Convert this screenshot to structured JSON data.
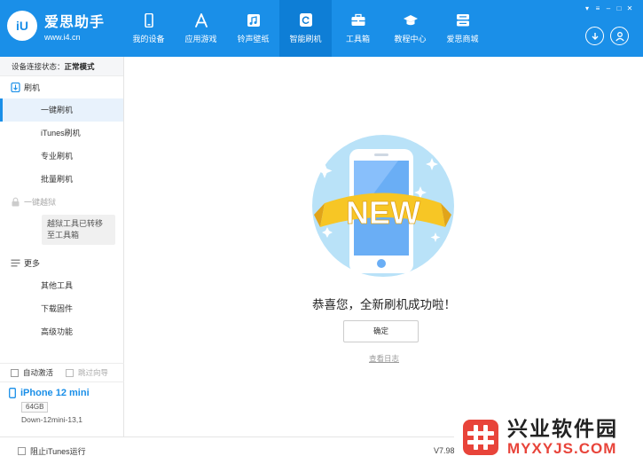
{
  "app": {
    "logo_badge": "iU",
    "name": "爱思助手",
    "url": "www.i4.cn"
  },
  "nav": {
    "items": [
      {
        "label": "我的设备",
        "icon": "phone-icon"
      },
      {
        "label": "应用游戏",
        "icon": "app-store-icon"
      },
      {
        "label": "铃声壁纸",
        "icon": "music-wallpaper-icon"
      },
      {
        "label": "智能刷机",
        "icon": "flash-refresh-icon",
        "active": true
      },
      {
        "label": "工具箱",
        "icon": "toolbox-icon"
      },
      {
        "label": "教程中心",
        "icon": "graduation-cap-icon"
      },
      {
        "label": "爱思商城",
        "icon": "store-icon"
      }
    ]
  },
  "window_controls": [
    "▾",
    "≡",
    "–",
    "□",
    "✕"
  ],
  "sidebar": {
    "status_label": "设备连接状态：",
    "status_value": "正常模式",
    "flash_section": "刷机",
    "flash_items": [
      "一键刷机",
      "iTunes刷机",
      "专业刷机",
      "批量刷机"
    ],
    "jailbreak_section": "一键越狱",
    "jailbreak_note": "越狱工具已转移至工具箱",
    "more_section": "更多",
    "more_items": [
      "其他工具",
      "下载固件",
      "高级功能"
    ],
    "auto_activate": "自动激活",
    "skip_guide": "跳过向导",
    "device_name": "iPhone 12 mini",
    "device_capacity": "64GB",
    "device_model": "Down-12mini-13,1"
  },
  "main": {
    "badge_text": "NEW",
    "success_message": "恭喜您，全新刷机成功啦！",
    "ok_button": "确定",
    "view_log": "查看日志"
  },
  "footer": {
    "block_itunes": "阻止iTunes运行",
    "version": "V7.98"
  },
  "watermark": {
    "cn": "兴业软件园",
    "en": "MYXYJS.COM"
  },
  "colors": {
    "brand_blue": "#1a8fe8",
    "watermark_red": "#e8443a"
  }
}
